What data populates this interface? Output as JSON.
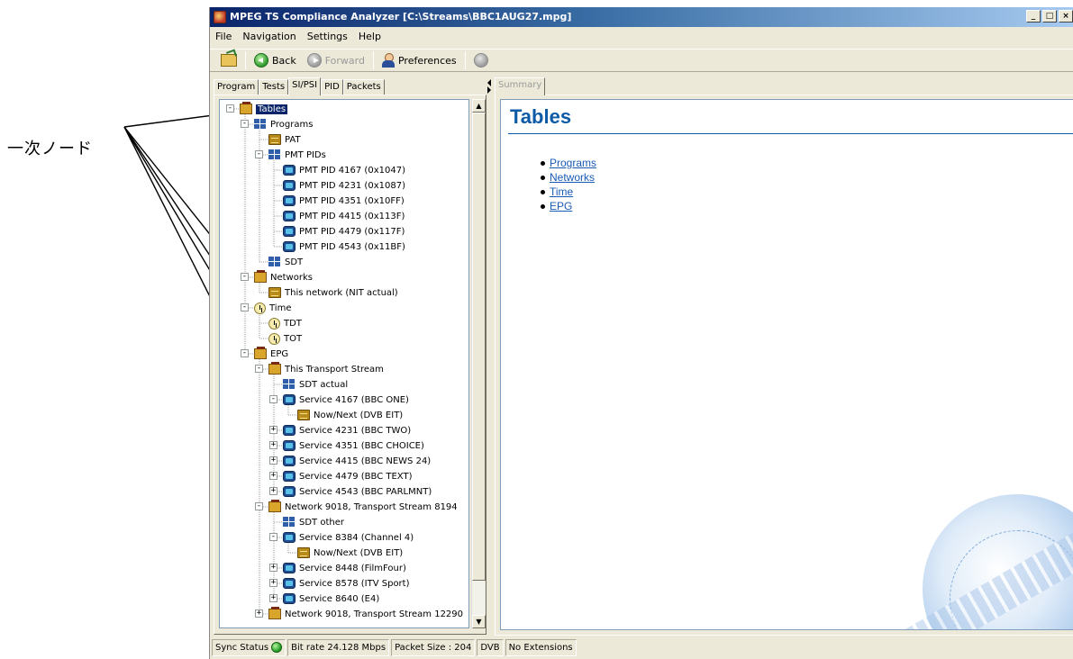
{
  "annotation": {
    "label": "一次ノード"
  },
  "window": {
    "title": "MPEG TS Compliance Analyzer [C:\\Streams\\BBC1AUG27.mpg]",
    "controls": [
      "_",
      "□",
      "×"
    ]
  },
  "menu": [
    "File",
    "Navigation",
    "Settings",
    "Help"
  ],
  "toolbar": {
    "back": "Back",
    "forward": "Forward",
    "preferences": "Preferences"
  },
  "left_tabs": [
    "Program",
    "Tests",
    "SI/PSI",
    "PID",
    "Packets"
  ],
  "active_left_tab": "SI/PSI",
  "tree": [
    {
      "label": "Tables",
      "icon": "table-folder-icon",
      "selected": true
    },
    {
      "label": "Programs",
      "icon": "grid-icon"
    },
    {
      "label": "PAT",
      "icon": "table-icon"
    },
    {
      "label": "PMT PIDs",
      "icon": "grid-icon"
    },
    {
      "label": "PMT PID 4167 (0x1047)",
      "icon": "tv-icon"
    },
    {
      "label": "PMT PID 4231 (0x1087)",
      "icon": "tv-icon"
    },
    {
      "label": "PMT PID 4351 (0x10FF)",
      "icon": "tv-icon"
    },
    {
      "label": "PMT PID 4415 (0x113F)",
      "icon": "tv-icon"
    },
    {
      "label": "PMT PID 4479 (0x117F)",
      "icon": "tv-icon"
    },
    {
      "label": "PMT PID 4543 (0x11BF)",
      "icon": "tv-icon"
    },
    {
      "label": "SDT",
      "icon": "grid-icon"
    },
    {
      "label": "Networks",
      "icon": "table-folder-icon"
    },
    {
      "label": "This network (NIT actual)",
      "icon": "table-icon"
    },
    {
      "label": "Time",
      "icon": "clock-icon"
    },
    {
      "label": "TDT",
      "icon": "clock-icon"
    },
    {
      "label": "TOT",
      "icon": "clock-icon"
    },
    {
      "label": "EPG",
      "icon": "table-folder-icon"
    },
    {
      "label": "This Transport Stream",
      "icon": "table-folder-icon"
    },
    {
      "label": "SDT actual",
      "icon": "grid-icon"
    },
    {
      "label": "Service 4167 (BBC ONE)",
      "icon": "tv-icon"
    },
    {
      "label": "Now/Next (DVB EIT)",
      "icon": "table-icon"
    },
    {
      "label": "Service 4231 (BBC TWO)",
      "icon": "tv-icon"
    },
    {
      "label": "Service 4351 (BBC CHOICE)",
      "icon": "tv-icon"
    },
    {
      "label": "Service 4415 (BBC NEWS 24)",
      "icon": "tv-icon"
    },
    {
      "label": "Service 4479 (BBC TEXT)",
      "icon": "tv-icon"
    },
    {
      "label": "Service 4543 (BBC PARLMNT)",
      "icon": "tv-icon"
    },
    {
      "label": "Network 9018, Transport Stream 8194",
      "icon": "table-folder-icon"
    },
    {
      "label": "SDT other",
      "icon": "grid-icon"
    },
    {
      "label": "Service 8384 (Channel 4)",
      "icon": "tv-icon"
    },
    {
      "label": "Now/Next (DVB EIT)",
      "icon": "table-icon"
    },
    {
      "label": "Service 8448 (FilmFour)",
      "icon": "tv-icon"
    },
    {
      "label": "Service 8578 (ITV Sport)",
      "icon": "tv-icon"
    },
    {
      "label": "Service 8640 (E4)",
      "icon": "tv-icon"
    },
    {
      "label": "Network 9018, Transport Stream 12290",
      "icon": "table-folder-icon"
    }
  ],
  "right_tabs": [
    "Summary"
  ],
  "content": {
    "title": "Tables",
    "links": [
      "Programs",
      "Networks",
      "Time",
      "EPG"
    ]
  },
  "status": {
    "sync": "Sync Status",
    "bitrate": "Bit rate  24.128 Mbps",
    "packet_size": "Packet Size : 204",
    "standard": "DVB",
    "extensions": "No Extensions"
  }
}
